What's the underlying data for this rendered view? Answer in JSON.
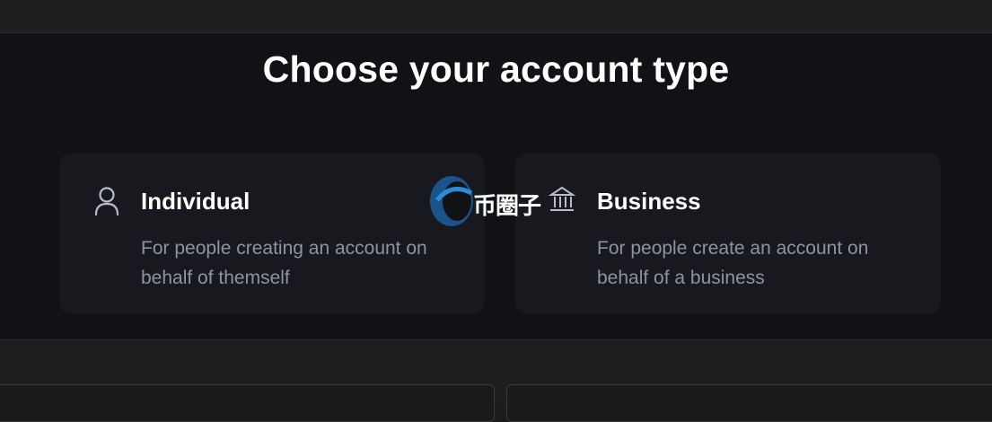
{
  "page": {
    "title": "Choose your account type"
  },
  "cards": {
    "individual": {
      "icon": "user-icon",
      "title": "Individual",
      "description": "For people creating an account on behalf of themself"
    },
    "business": {
      "icon": "bank-icon",
      "title": "Business",
      "description": "For people create an account on behalf of a business"
    }
  },
  "watermark": {
    "text": "币圈子"
  },
  "colors": {
    "background": "#111216",
    "card": "#18191e",
    "text_primary": "#ffffff",
    "text_secondary": "#8e93a1"
  }
}
